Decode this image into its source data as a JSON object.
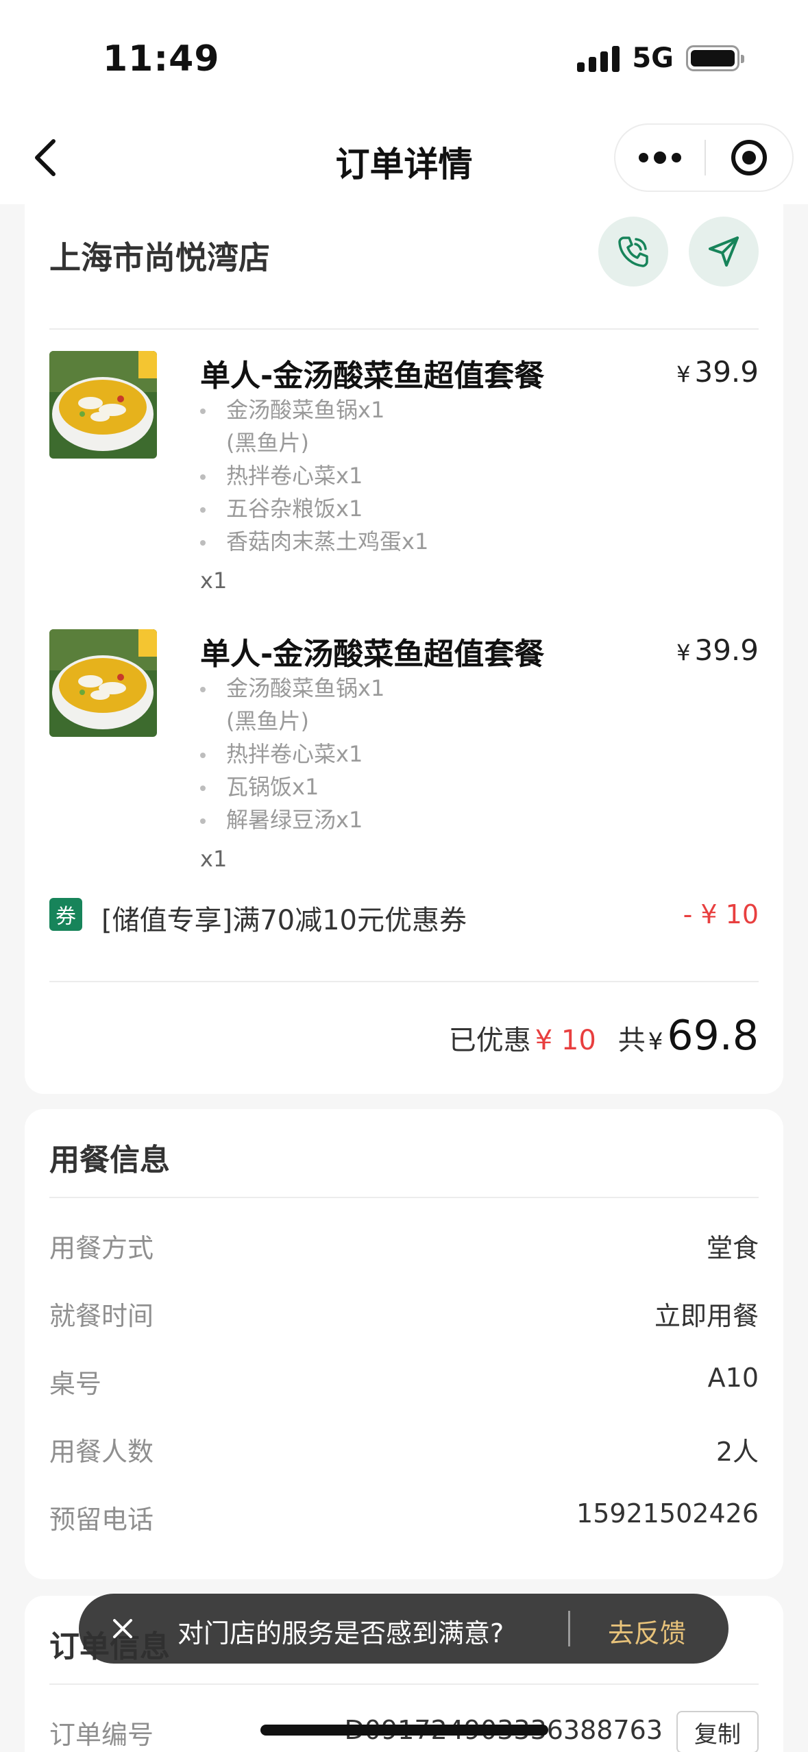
{
  "status_bar": {
    "time": "11:49",
    "network": "5G"
  },
  "nav": {
    "title": "订单详情"
  },
  "store": {
    "name": "上海市尚悦湾店"
  },
  "items": [
    {
      "title": "单人-金汤酸菜鱼超值套餐",
      "price_symbol": "¥",
      "price": "39.9",
      "subs": [
        {
          "name": "金汤酸菜鱼锅x1",
          "cont": "(黑鱼片)"
        },
        {
          "name": "热拌卷心菜x1",
          "cont": ""
        },
        {
          "name": "五谷杂粮饭x1",
          "cont": ""
        },
        {
          "name": "香菇肉末蒸土鸡蛋x1",
          "cont": ""
        }
      ],
      "qty": "x1"
    },
    {
      "title": "单人-金汤酸菜鱼超值套餐",
      "price_symbol": "¥",
      "price": "39.9",
      "subs": [
        {
          "name": "金汤酸菜鱼锅x1",
          "cont": "(黑鱼片)"
        },
        {
          "name": "热拌卷心菜x1",
          "cont": ""
        },
        {
          "name": "瓦锅饭x1",
          "cont": ""
        },
        {
          "name": "解暑绿豆汤x1",
          "cont": ""
        }
      ],
      "qty": "x1"
    }
  ],
  "coupon": {
    "tag": "券",
    "text": "[储值专享]满70减10元优惠券",
    "amount": "- ¥ 10"
  },
  "total": {
    "discount_label": "已优惠",
    "discount": "¥ 10",
    "total_label": "共",
    "yen": "¥",
    "amount": "69.8"
  },
  "dining": {
    "title": "用餐信息",
    "rows": [
      {
        "label": "用餐方式",
        "value": "堂食"
      },
      {
        "label": "就餐时间",
        "value": "立即用餐"
      },
      {
        "label": "桌号",
        "value": "A10"
      },
      {
        "label": "用餐人数",
        "value": "2人"
      },
      {
        "label": "预留电话",
        "value": "15921502426"
      }
    ]
  },
  "order_info": {
    "title": "订单信息",
    "order_no_label": "订单编号",
    "order_no": "D091724903336388763",
    "copy_label": "复制"
  },
  "toast": {
    "text": "对门店的服务是否感到满意?",
    "action": "去反馈"
  },
  "colors": {
    "accent_green": "#17845a",
    "price_red": "#e83f3f",
    "toast_gold": "#e7c27a"
  }
}
